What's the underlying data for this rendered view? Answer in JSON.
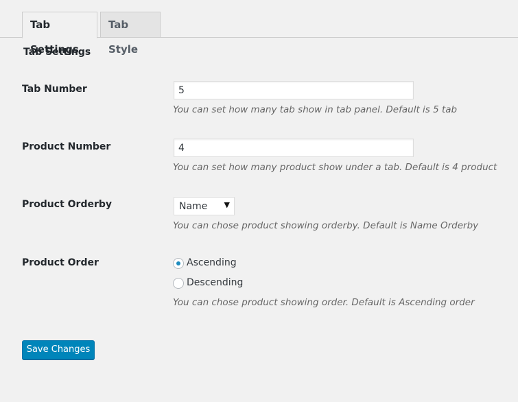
{
  "tabs": [
    {
      "label": "Tab Settings",
      "active": true
    },
    {
      "label": "Tab Style",
      "active": false
    }
  ],
  "section_title": "Tab Settings",
  "fields": {
    "tab_number": {
      "label": "Tab Number",
      "value": "5",
      "description": "You can set how many tab show in tab panel. Default is 5 tab"
    },
    "product_number": {
      "label": "Product Number",
      "value": "4",
      "description": "You can set how many product show under a tab. Default is 4 product"
    },
    "product_orderby": {
      "label": "Product Orderby",
      "selected": "Name",
      "description": "You can chose product showing orderby. Default is Name Orderby"
    },
    "product_order": {
      "label": "Product Order",
      "options": [
        {
          "label": "Ascending",
          "checked": true
        },
        {
          "label": "Descending",
          "checked": false
        }
      ],
      "description": "You can chose product showing order. Default is Ascending order"
    }
  },
  "save_button": {
    "label": "Save Changes"
  },
  "colors": {
    "primary_button": "#0085ba",
    "radio_checked": "#1e8cbe",
    "background": "#f1f1f1"
  }
}
